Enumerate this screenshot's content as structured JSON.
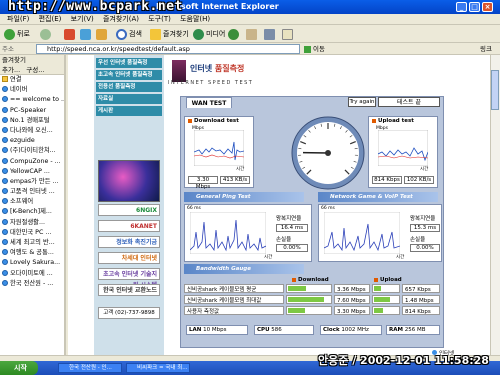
{
  "window": {
    "title": "http://www.bcpark.net",
    "title_suffix": "Microsoft Internet Explorer",
    "minimize": "_",
    "maximize": "□",
    "close": "×"
  },
  "menu": [
    "파일(F)",
    "편집(E)",
    "보기(V)",
    "즐겨찾기(A)",
    "도구(T)",
    "도움말(H)"
  ],
  "toolbar": {
    "back": "뒤로",
    "search": "검색",
    "favorites": "즐겨찾기",
    "media": "미디어"
  },
  "address": {
    "url": "http://speed.nca.or.kr/speedtest/default.asp",
    "go": "이동",
    "links": "링크"
  },
  "sidebar": {
    "title": "즐겨찾기",
    "add": "추가...",
    "organize": "구성...",
    "items": [
      "연결",
      "네이버",
      "== welcome to ...",
      "PC-Speaker",
      "No.1 경매포털",
      "다나와에 오신...",
      "ezguide",
      "(주)다이티한쳐...",
      "CompuZone - ...",
      "YellowCAP ...",
      "empas가 만든 ...",
      "고품격 인터넷 ...",
      "소프웨어",
      "[K-Bench]제...",
      "자원절생활...",
      "대한민국 PC ...",
      "세계 최고의 반...",
      "여행도 & 공통...",
      "Lovely Sakura...",
      "오다이미토에 ...",
      "한국 전산원 - ..."
    ]
  },
  "nav": {
    "items": [
      "우선 인터넷 품질측정",
      "초고속 인터넷 품질측정",
      "전용선 품질측정",
      "자료실",
      "게시판"
    ],
    "banners": [
      "6NGIX",
      "6KANET",
      "정보화 촉진기금",
      "차세대 인터넷",
      "초고속 인터넷 기술지원 시스템",
      "한국 인터넷 교환노드"
    ],
    "phone": "고객 (02)-737-9898"
  },
  "logo": {
    "title_a": "인터넷",
    "title_b": "품질측정",
    "subtitle": "INTERNET SPEED TEST"
  },
  "test": {
    "tab": "WAN TEST",
    "try_again": "Try again",
    "test_name": "테스트 끝",
    "download": {
      "title": "Download test",
      "unit_top": "Mbps",
      "time_label": "시간",
      "seconds": "3.30 Mbps",
      "kbps": "413 KB/s"
    },
    "upload": {
      "title": "Upload test",
      "unit_top": "Mbps",
      "time_label": "시간",
      "mbps": "814 Kbps",
      "kbps": "102 KB/s"
    },
    "gauge": {
      "value": 1.7
    },
    "ping": {
      "title": "General Ping Test",
      "ms_label": "66 ms",
      "delay_label": "왕복지연율",
      "delay": "16.4 ms",
      "loss_label": "손실율",
      "loss": "0.00%",
      "time_label": "시간"
    },
    "voip": {
      "title": "Network Game & VoIP Test",
      "ms_label": "66 ms",
      "delay_label": "왕복지연율",
      "delay": "15.3 ms",
      "loss_label": "손실율",
      "loss": "0.00%",
      "time_label": "시간"
    },
    "bandwidth": {
      "title": "Bandwidth Gauge",
      "download_header": "Download",
      "upload_header": "Upload",
      "rows": [
        {
          "label": "신비공shark 케이블모뎀 평균",
          "down": "3.36 Mbps",
          "down_frac": 0.42,
          "up": "657 Kbps",
          "up_frac": 0.3
        },
        {
          "label": "신비공shark 케이블모뎀 최대값",
          "down": "7.60 Mbps",
          "down_frac": 0.85,
          "up": "1.48 Mbps",
          "up_frac": 0.68
        },
        {
          "label": "사용자 측정값",
          "down": "3.30 Mbps",
          "down_frac": 0.41,
          "up": "814 Kbps",
          "up_frac": 0.37
        }
      ]
    },
    "system": {
      "lan_label": "LAN",
      "lan": "10 Mbps",
      "cpu_label": "CPU",
      "cpu": "586",
      "clock_label": "Clock",
      "clock": "1002 MHz",
      "ram_label": "RAM",
      "ram": "256 MB"
    }
  },
  "taskbar": {
    "start": "시작",
    "tasks": [
      "한국 전산원 - 인...",
      "비씨파크 = 국내 최..."
    ],
    "overlay": "안응준 / 2002-12-01 11:58:28",
    "status": "인터넷"
  }
}
